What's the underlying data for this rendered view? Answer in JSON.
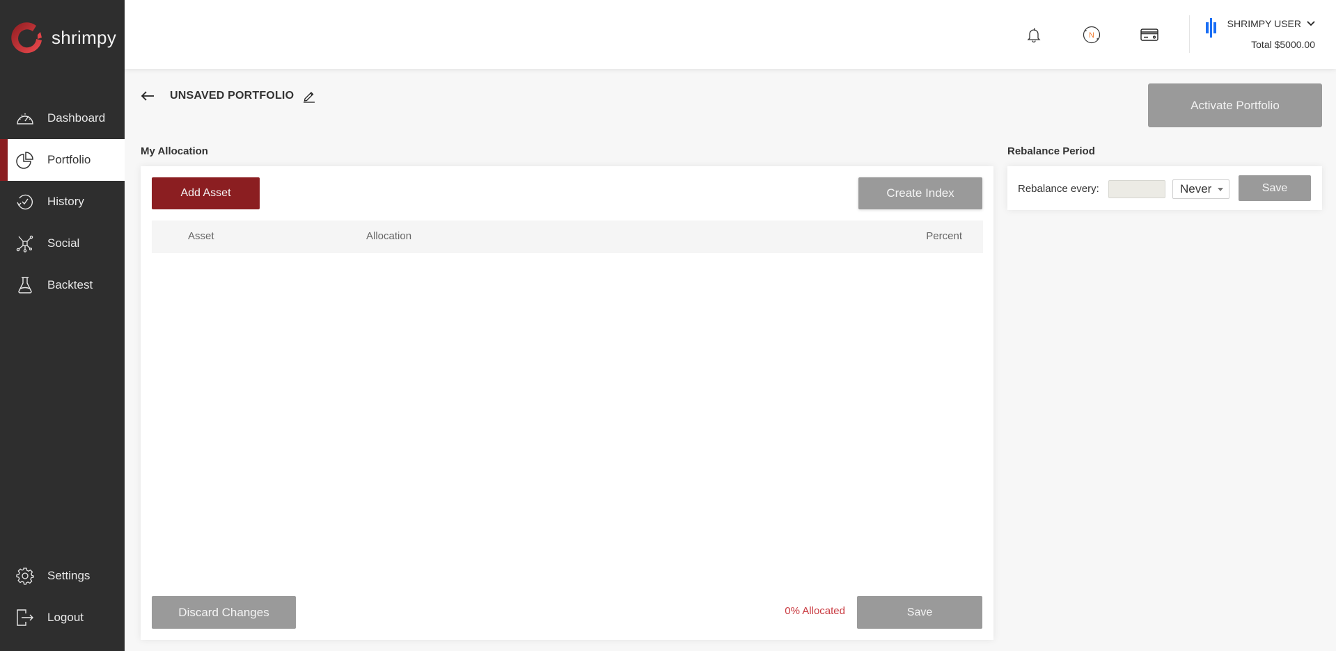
{
  "app": {
    "brand": "shrimpy",
    "accent": "#8b1e21"
  },
  "sidebar": {
    "items": [
      {
        "label": "Dashboard",
        "icon": "speedometer-icon"
      },
      {
        "label": "Portfolio",
        "icon": "pie-chart-icon",
        "active": true
      },
      {
        "label": "History",
        "icon": "history-icon"
      },
      {
        "label": "Social",
        "icon": "network-icon"
      },
      {
        "label": "Backtest",
        "icon": "flask-icon"
      }
    ],
    "bottom_items": [
      {
        "label": "Settings",
        "icon": "gear-icon"
      },
      {
        "label": "Logout",
        "icon": "logout-icon"
      }
    ]
  },
  "header": {
    "icons": [
      "bell-icon",
      "n-coin-icon",
      "credit-card-icon"
    ],
    "coin_letter": "N",
    "user_name": "SHRIMPY USER",
    "total": "Total $5000.00"
  },
  "page": {
    "title": "UNSAVED PORTFOLIO",
    "activate_label": "Activate Portfolio"
  },
  "allocation": {
    "section_label": "My Allocation",
    "add_asset_label": "Add Asset",
    "create_index_label": "Create Index",
    "columns": [
      "Asset",
      "Allocation",
      "Percent"
    ],
    "rows": [],
    "discard_label": "Discard Changes",
    "allocated_text": "0% Allocated",
    "save_label": "Save"
  },
  "rebalance": {
    "section_label": "Rebalance Period",
    "label": "Rebalance every:",
    "input_value": "",
    "selected_period": "Never",
    "save_label": "Save"
  }
}
